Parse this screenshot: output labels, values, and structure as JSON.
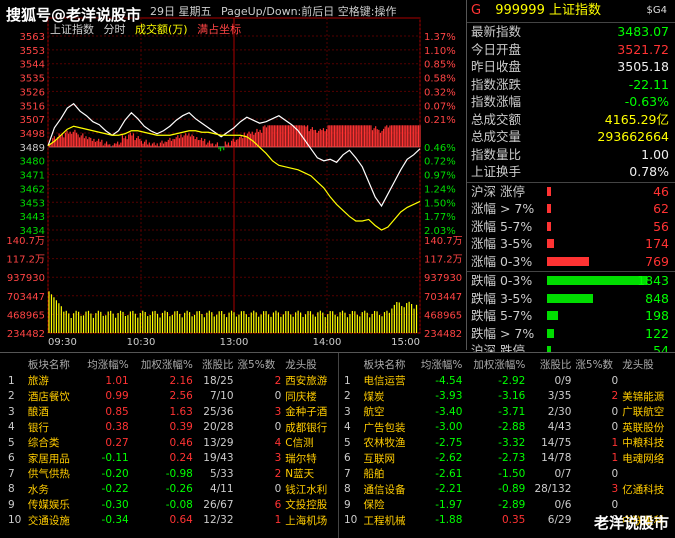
{
  "watermark_top": "搜狐号@老洋说股市",
  "watermark_bottom": "老洋说股市",
  "chart": {
    "header_date_text": "29日 星期五",
    "header_hint": "PageUp/Down:前后日 空格键:操作",
    "label_index": "上证指数",
    "label_minute": "分时",
    "label_volume": "成交额(万)",
    "label_dots": "满占坐标",
    "left_axis": [
      "3563",
      "3553",
      "3544",
      "3535",
      "3526",
      "3516",
      "3507",
      "3498",
      "3489",
      "3480",
      "3471",
      "3462",
      "3453",
      "3443",
      "3434",
      "140.7万",
      "117.2万",
      "937930",
      "703447",
      "468965",
      "234482"
    ],
    "right_axis": [
      "1.37%",
      "1.10%",
      "0.85%",
      "0.58%",
      "0.32%",
      "0.07%",
      "0.21%",
      "0.46%",
      "0.72%",
      "0.97%",
      "1.24%",
      "1.50%",
      "1.77%",
      "2.03%",
      "140.7万",
      "117.2万",
      "937930",
      "703447",
      "468965",
      "234482"
    ],
    "time_labels": [
      "09:30",
      "10:30",
      "13:00",
      "14:00",
      "15:00"
    ],
    "price_line": [
      3490,
      3502,
      3508,
      3515,
      3518,
      3513,
      3510,
      3506,
      3504,
      3500,
      3497,
      3500,
      3507,
      3512,
      3508,
      3503,
      3500,
      3498,
      3500,
      3503,
      3507,
      3510,
      3512,
      3508,
      3505,
      3502,
      3499,
      3496,
      3499,
      3502,
      3506,
      3509,
      3507,
      3505,
      3506,
      3508,
      3510,
      3507,
      3504,
      3500,
      3494,
      3488,
      3482,
      3480,
      3481,
      3479,
      3484,
      3487,
      3482,
      3476,
      3466,
      3456,
      3450,
      3458,
      3466,
      3474,
      3481,
      3484,
      3488
    ],
    "avg_line": [
      3490,
      3493,
      3497,
      3501,
      3503,
      3502,
      3501,
      3500,
      3499,
      3498,
      3497,
      3497,
      3498,
      3500,
      3500,
      3499,
      3498,
      3497,
      3497,
      3497,
      3498,
      3499,
      3500,
      3500,
      3499,
      3499,
      3498,
      3497,
      3497,
      3497,
      3497,
      3496,
      3493,
      3489,
      3485,
      3480,
      3477,
      3476,
      3475,
      3474,
      3472,
      3470,
      3466,
      3462,
      3456,
      3451,
      3447,
      3443,
      3440,
      3440,
      3441,
      3437,
      3434,
      3436,
      3441,
      3446,
      3449,
      3451,
      3453
    ],
    "base_price": 3489,
    "price_min": 3434,
    "price_max": 3563,
    "vol_max": 140.7
  },
  "info": {
    "code": "999999",
    "name": "上证指数",
    "g_label": "G",
    "tag": "$G4",
    "rows": [
      {
        "label": "最新指数",
        "value": "3483.07",
        "color": "green"
      },
      {
        "label": "今日开盘",
        "value": "3521.72",
        "color": "red"
      },
      {
        "label": "昨日收盘",
        "value": "3505.18",
        "color": "white"
      },
      {
        "label": "指数涨跌",
        "value": "-22.11",
        "color": "green"
      },
      {
        "label": "指数涨幅",
        "value": "-0.63%",
        "color": "green"
      },
      {
        "label": "总成交额",
        "value": "4165.29亿",
        "color": "yellow"
      },
      {
        "label": "总成交量",
        "value": "293662664",
        "color": "yellow"
      },
      {
        "label": "指数量比",
        "value": "1.00",
        "color": "white"
      },
      {
        "label": "上证换手",
        "value": "0.78%",
        "color": "white"
      }
    ],
    "breadth_up": [
      {
        "label": "沪深 涨停",
        "value": "46",
        "frac": 0.02
      },
      {
        "label": "涨幅 > 7%",
        "value": "62",
        "frac": 0.03
      },
      {
        "label": "涨幅 5-7%",
        "value": "56",
        "frac": 0.03
      },
      {
        "label": "涨幅 3-5%",
        "value": "174",
        "frac": 0.07
      },
      {
        "label": "涨幅 0-3%",
        "value": "769",
        "frac": 0.42
      }
    ],
    "breadth_down": [
      {
        "label": "跌幅 0-3%",
        "value": "1843",
        "frac": 1.0
      },
      {
        "label": "跌幅 3-5%",
        "value": "848",
        "frac": 0.46
      },
      {
        "label": "跌幅 5-7%",
        "value": "198",
        "frac": 0.11
      },
      {
        "label": "跌幅 > 7%",
        "value": "122",
        "frac": 0.07
      },
      {
        "label": "沪深 跌停",
        "value": "54",
        "frac": 0.03
      }
    ]
  },
  "sectors_header": [
    "板块名称",
    "均涨幅%",
    "加权涨幅%",
    "涨股比",
    "涨5%数",
    "龙头股"
  ],
  "sectors_left": [
    {
      "n": "1",
      "name": "旅游",
      "avg": "1.01",
      "w": "2.16",
      "ratio": "18/25",
      "c5": "2",
      "lead": "西安旅游",
      "wc": "red"
    },
    {
      "n": "2",
      "name": "酒店餐饮",
      "avg": "0.99",
      "w": "2.56",
      "ratio": "7/10",
      "c5": "0",
      "lead": "同庆楼",
      "wc": "red"
    },
    {
      "n": "3",
      "name": "酿酒",
      "avg": "0.85",
      "w": "1.63",
      "ratio": "25/36",
      "c5": "3",
      "lead": "金种子酒",
      "wc": "red"
    },
    {
      "n": "4",
      "name": "银行",
      "avg": "0.38",
      "w": "0.39",
      "ratio": "20/28",
      "c5": "0",
      "lead": "成都银行",
      "wc": "red"
    },
    {
      "n": "5",
      "name": "综合类",
      "avg": "0.27",
      "w": "0.46",
      "ratio": "13/29",
      "c5": "4",
      "lead": "C信测",
      "wc": "red"
    },
    {
      "n": "6",
      "name": "家居用品",
      "avg": "-0.11",
      "w": "0.24",
      "ratio": "19/43",
      "c5": "3",
      "lead": "瑞尔特",
      "wc": "red"
    },
    {
      "n": "7",
      "name": "供气供热",
      "avg": "-0.20",
      "w": "-0.98",
      "ratio": "5/33",
      "c5": "2",
      "lead": "N蓝天",
      "wc": "green"
    },
    {
      "n": "8",
      "name": "水务",
      "avg": "-0.22",
      "w": "-0.26",
      "ratio": "4/11",
      "c5": "0",
      "lead": "钱江水利",
      "wc": "green"
    },
    {
      "n": "9",
      "name": "传媒娱乐",
      "avg": "-0.30",
      "w": "-0.08",
      "ratio": "26/67",
      "c5": "6",
      "lead": "文投控股",
      "wc": "green"
    },
    {
      "n": "10",
      "name": "交通设施",
      "avg": "-0.34",
      "w": "0.64",
      "ratio": "12/32",
      "c5": "1",
      "lead": "上海机场",
      "wc": "red"
    }
  ],
  "sectors_right": [
    {
      "n": "1",
      "name": "电信运营",
      "avg": "-4.54",
      "w": "-2.92",
      "ratio": "0/9",
      "c5": "0",
      "lead": "",
      "wc": "green"
    },
    {
      "n": "2",
      "name": "煤炭",
      "avg": "-3.93",
      "w": "-3.16",
      "ratio": "3/35",
      "c5": "2",
      "lead": "美锦能源",
      "wc": "green"
    },
    {
      "n": "3",
      "name": "航空",
      "avg": "-3.40",
      "w": "-3.71",
      "ratio": "2/30",
      "c5": "0",
      "lead": "广联航空",
      "wc": "green"
    },
    {
      "n": "4",
      "name": "广告包装",
      "avg": "-3.00",
      "w": "-2.88",
      "ratio": "4/43",
      "c5": "0",
      "lead": "英联股份",
      "wc": "green"
    },
    {
      "n": "5",
      "name": "农林牧渔",
      "avg": "-2.75",
      "w": "-3.32",
      "ratio": "14/75",
      "c5": "1",
      "lead": "中粮科技",
      "wc": "green"
    },
    {
      "n": "6",
      "name": "互联网",
      "avg": "-2.62",
      "w": "-2.73",
      "ratio": "14/78",
      "c5": "1",
      "lead": "电魂网络",
      "wc": "green"
    },
    {
      "n": "7",
      "name": "船舶",
      "avg": "-2.61",
      "w": "-1.50",
      "ratio": "0/7",
      "c5": "0",
      "lead": "",
      "wc": "green"
    },
    {
      "n": "8",
      "name": "通信设备",
      "avg": "-2.21",
      "w": "-0.89",
      "ratio": "28/132",
      "c5": "3",
      "lead": "亿通科技",
      "wc": "green"
    },
    {
      "n": "9",
      "name": "保险",
      "avg": "-1.97",
      "w": "-2.89",
      "ratio": "0/6",
      "c5": "0",
      "lead": "",
      "wc": "green"
    },
    {
      "n": "10",
      "name": "工程机械",
      "avg": "-1.88",
      "w": "0.35",
      "ratio": "6/29",
      "c5": "0",
      "lead": "中联重科",
      "wc": "red"
    }
  ]
}
